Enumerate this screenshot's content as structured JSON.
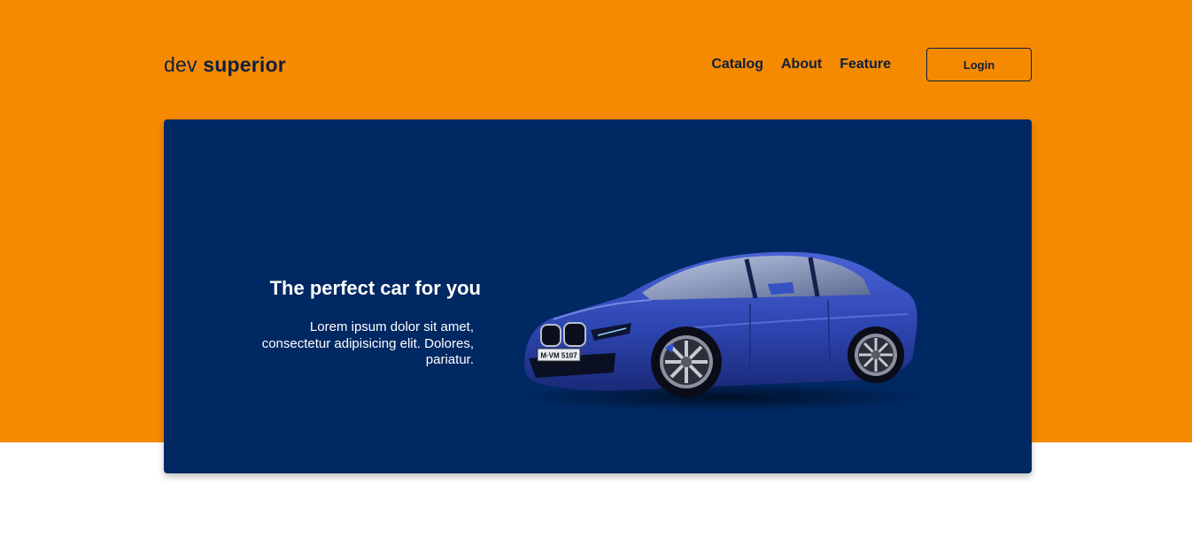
{
  "header": {
    "brand_light": "dev",
    "brand_bold": "superior",
    "nav": [
      {
        "label": "Catalog"
      },
      {
        "label": "About"
      },
      {
        "label": "Feature"
      }
    ],
    "login_label": "Login"
  },
  "hero": {
    "title": "The perfect car for you",
    "description": "Lorem ipsum dolor sit amet, consectetur adipisicing elit. Dolores, pariatur.",
    "plate": "M·VM 5107"
  },
  "colors": {
    "orange": "#f58a00",
    "navy": "#002862",
    "dark_text": "#0e1f3f",
    "car_blue": "#2d45b0"
  }
}
